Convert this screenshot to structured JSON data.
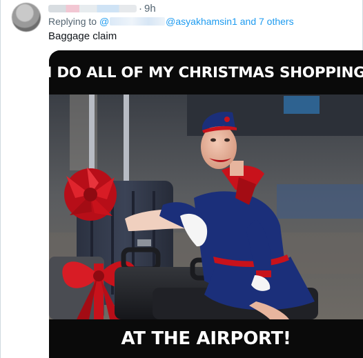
{
  "tweet": {
    "time": "9h",
    "separator": "·",
    "replying_prefix": "Replying to",
    "mention_at": "@",
    "mention_handle": "@asyakhamsin1",
    "mention_rest": "and 7 others",
    "text": "Baggage claim"
  },
  "meme": {
    "top_caption": "I DO ALL OF MY CHRISTMAS SHOPPING",
    "bottom_caption": "AT THE AIRPORT!"
  },
  "colors": {
    "link": "#1d9bf0",
    "secondary_text": "#536471",
    "uniform": "#1b2f7a",
    "bow": "#c8121b"
  }
}
